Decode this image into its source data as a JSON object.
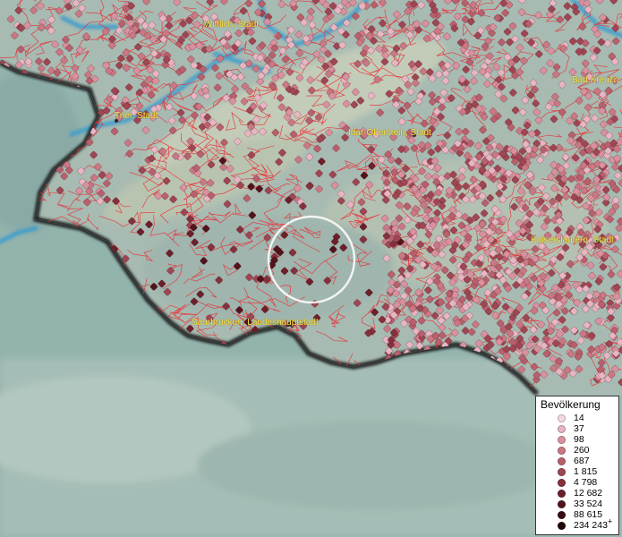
{
  "map": {
    "places": [
      {
        "name": "Wittlich, Stadt"
      },
      {
        "name": "Trier, Stadt"
      },
      {
        "name": "Idar-Oberstein, Stadt"
      },
      {
        "name": "Bad Kreuzn"
      },
      {
        "name": "Kaiserslautern, Stadt"
      },
      {
        "name": "Saarbrücken, Landeshauptstadt"
      }
    ],
    "legend": {
      "title": "Bevölkerung",
      "classes": [
        {
          "label": "14",
          "color": "#f4d9e2"
        },
        {
          "label": "37",
          "color": "#e8b5c3"
        },
        {
          "label": "98",
          "color": "#d9919f"
        },
        {
          "label": "260",
          "color": "#c97884"
        },
        {
          "label": "687",
          "color": "#b8606d"
        },
        {
          "label": "1 815",
          "color": "#9e4653"
        },
        {
          "label": "4 798",
          "color": "#85313d"
        },
        {
          "label": "12 682",
          "color": "#6c202b"
        },
        {
          "label": "33 524",
          "color": "#52141c"
        },
        {
          "label": "88 615",
          "color": "#3a0b10"
        },
        {
          "label": "234 243",
          "color": "#200406",
          "suffix": "+"
        }
      ]
    },
    "colors": {
      "sea": "#8fb1ab",
      "land": "#a8bdb3",
      "border": "#111111",
      "boundaries": "#e8323a",
      "rivers": "#3a9ccf",
      "city_label": "#ffe34a",
      "marker_base": "#c97884"
    }
  }
}
